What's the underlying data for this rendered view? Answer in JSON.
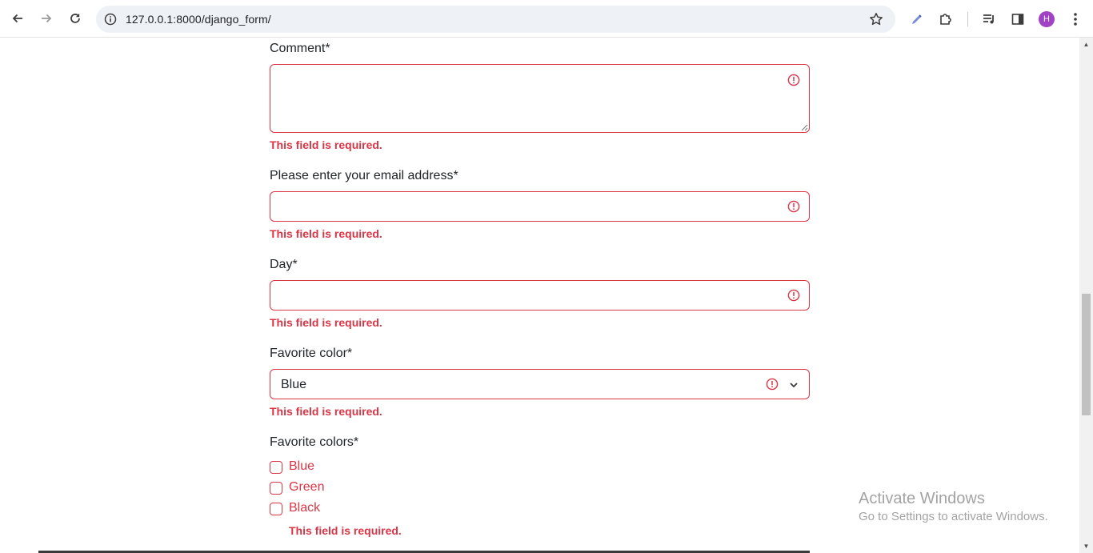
{
  "browser": {
    "url": "127.0.0.1:8000/django_form/",
    "avatar_letter": "H",
    "accent_color": "#a142c4"
  },
  "form": {
    "comment": {
      "label": "Comment*",
      "value": "",
      "error": "This field is required."
    },
    "email": {
      "label": "Please enter your email address*",
      "value": "",
      "error": "This field is required."
    },
    "day": {
      "label": "Day*",
      "value": "",
      "error": "This field is required."
    },
    "favorite_color": {
      "label": "Favorite color*",
      "selected": "Blue",
      "error": "This field is required."
    },
    "favorite_colors": {
      "label": "Favorite colors*",
      "options": [
        "Blue",
        "Green",
        "Black"
      ],
      "error": "This field is required."
    },
    "error_color": "#dc3545"
  },
  "watermark": {
    "title": "Activate Windows",
    "subtitle": "Go to Settings to activate Windows."
  }
}
